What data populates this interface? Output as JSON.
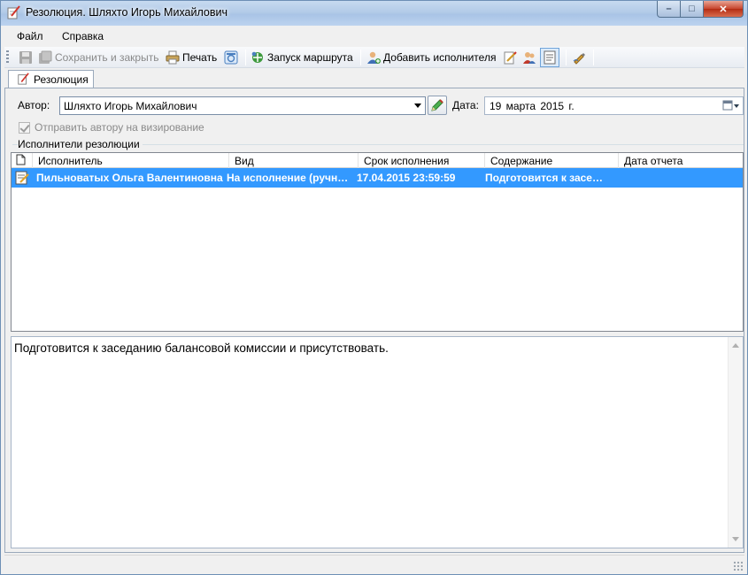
{
  "window": {
    "title": "Резолюция. Шляхто Игорь Михайлович",
    "controls": {
      "minimize": "–",
      "maximize": "□",
      "close": "✕"
    }
  },
  "menu": {
    "items": [
      "Файл",
      "Справка"
    ]
  },
  "toolbar": {
    "save_and_close": "Сохранить и закрыть",
    "print": "Печать",
    "start_route": "Запуск маршрута",
    "add_executor": "Добавить исполнителя"
  },
  "tabs": [
    {
      "label": "Резолюция"
    }
  ],
  "form": {
    "author_label": "Автор:",
    "author_value": "Шляхто Игорь Михайлович",
    "date_label": "Дата:",
    "date_value": "19   марта   2015 г.",
    "send_to_author_label": "Отправить автору на визирование",
    "send_to_author_checked": true
  },
  "executors": {
    "group_title": "Исполнители резолюции",
    "columns": [
      "Исполнитель",
      "Вид",
      "Срок исполнения",
      "Содержание",
      "Дата отчета"
    ],
    "rows": [
      {
        "executor": "Пильноватых Ольга Валентиновна",
        "kind": "На исполнение (ручн…",
        "deadline": "17.04.2015 23:59:59",
        "content": "Подготовится к засе…",
        "report_date": ""
      }
    ]
  },
  "memo": {
    "text": "Подготовится к заседанию балансовой комиссии и присутствовать."
  },
  "colors": {
    "selection": "#3399ff",
    "titlebar": "#b3cbe8",
    "close_button": "#c7452d"
  }
}
